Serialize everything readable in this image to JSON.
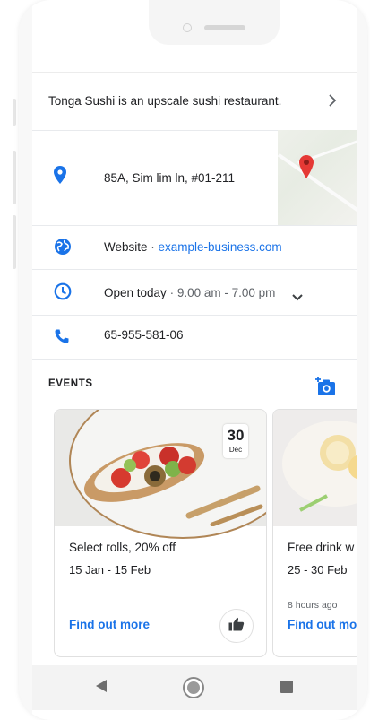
{
  "description": {
    "text": "Tonga Sushi is an upscale sushi restaurant.",
    "chevron": "chevron-right-icon"
  },
  "address": {
    "text": "85A, Sim lim ln, #01-211",
    "icon": "location-pin-icon"
  },
  "website": {
    "label": "Website",
    "separator": " · ",
    "url": "example-business.com",
    "icon": "globe-icon"
  },
  "hours": {
    "label": "Open today",
    "separator": " · ",
    "time": "9.00 am - 7.00 pm",
    "icon": "clock-icon",
    "expand_icon": "chevron-down-icon"
  },
  "phone": {
    "number": "65-955-581-06",
    "icon": "phone-icon"
  },
  "events": {
    "title": "EVENTS",
    "add_icon": "add-photo-icon",
    "cards": [
      {
        "date_day": "30",
        "date_month": "Dec",
        "title": "Select rolls, 20% off",
        "dates": "15 Jan - 15 Feb",
        "link": "Find out more",
        "like_icon": "thumbs-up-icon"
      },
      {
        "title": "Free drink w",
        "dates": "25 - 30 Feb",
        "posted": "8 hours ago",
        "link": "Find out mo"
      }
    ]
  },
  "navbar": {
    "back_icon": "back-triangle-icon",
    "home_icon": "home-circle-icon",
    "recents_icon": "recents-square-icon"
  },
  "colors": {
    "accent": "#1a73e8",
    "icon_blue": "#1a73e8",
    "text": "#202124",
    "muted": "#5f6368",
    "pin_red": "#e53935"
  }
}
